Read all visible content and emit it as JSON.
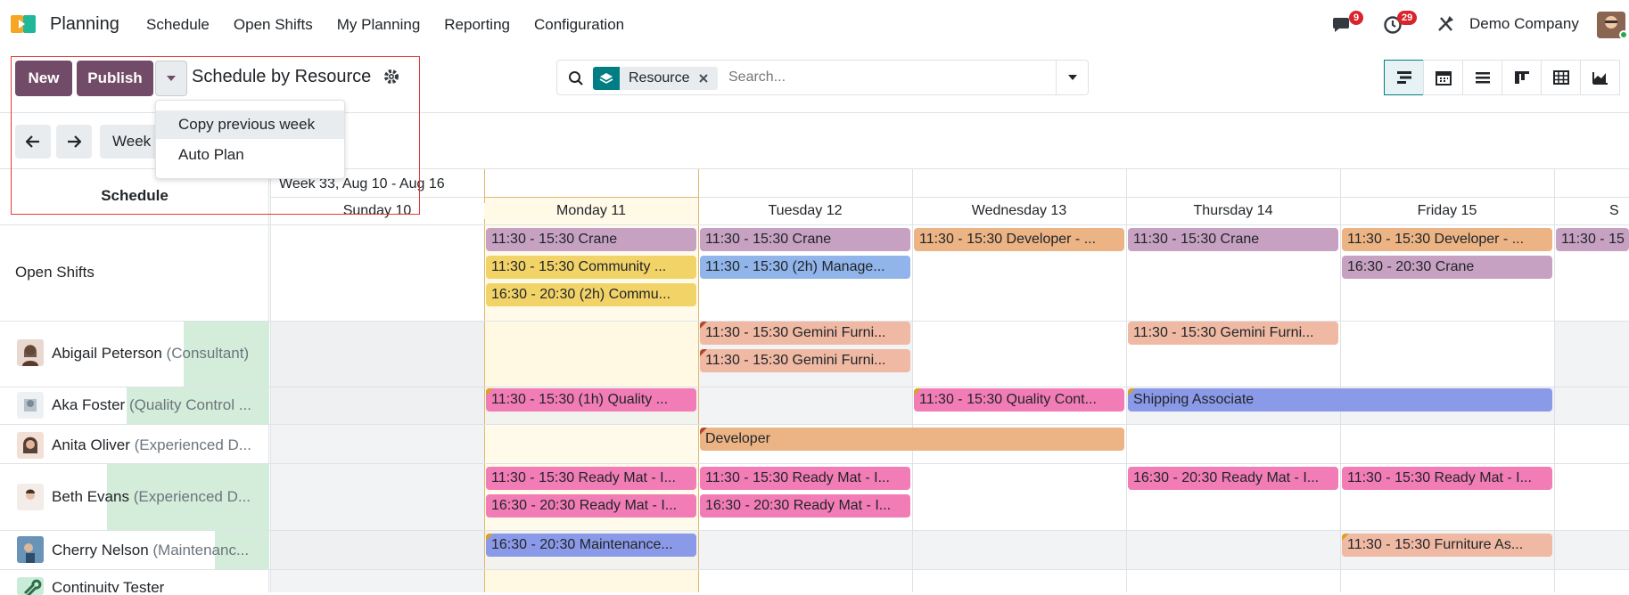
{
  "nav": {
    "app_name": "Planning",
    "menu": [
      "Schedule",
      "Open Shifts",
      "My Planning",
      "Reporting",
      "Configuration"
    ],
    "messages_count": "9",
    "activities_count": "29",
    "company": "Demo Company"
  },
  "control": {
    "new_label": "New",
    "publish_label": "Publish",
    "title": "Schedule by Resource",
    "facet": "Resource",
    "search_placeholder": "Search...",
    "dropdown": [
      "Copy previous week",
      "Auto Plan"
    ],
    "week_label": "Week"
  },
  "gantt": {
    "left_header": "Schedule",
    "range_label": "Week 33, Aug 10 - Aug 16",
    "days": [
      "Sunday 10",
      "Monday 11",
      "Tuesday 12",
      "Wednesday 13",
      "Thursday 14",
      "Friday 15",
      "S"
    ],
    "rows": [
      {
        "name": "Open Shifts",
        "role": ""
      },
      {
        "name": "Abigail Peterson",
        "role": "(Consultant)"
      },
      {
        "name": "Aka Foster",
        "role": "(Quality Control ..."
      },
      {
        "name": "Anita Oliver",
        "role": "(Experienced D..."
      },
      {
        "name": "Beth Evans",
        "role": "(Experienced D..."
      },
      {
        "name": "Cherry Nelson",
        "role": "(Maintenanc..."
      },
      {
        "name": "Continuity Tester",
        "role": ""
      }
    ],
    "shifts": {
      "os_mon_1": "11:30 - 15:30 Crane",
      "os_mon_2": "11:30 - 15:30 Community ...",
      "os_mon_3": "16:30 - 20:30 (2h) Commu...",
      "os_tue_1": "11:30 - 15:30 Crane",
      "os_tue_2": "11:30 - 15:30 (2h) Manage...",
      "os_wed_1": "11:30 - 15:30 Developer - ...",
      "os_thu_1": "11:30 - 15:30 Crane",
      "os_fri_1": "11:30 - 15:30 Developer - ...",
      "os_fri_2": "16:30 - 20:30 Crane",
      "os_sat_1": "11:30 - 15",
      "ab_tue_1": "11:30 - 15:30 Gemini Furni...",
      "ab_tue_2": "11:30 - 15:30 Gemini Furni...",
      "ab_thu_1": "11:30 - 15:30 Gemini Furni...",
      "ak_mon_1": "11:30 - 15:30 (1h) Quality ...",
      "ak_wed_1": "11:30 - 15:30 Quality Cont...",
      "ak_thu_1": "Shipping Associate",
      "an_tue_1": "Developer",
      "be_mon_1": "11:30 - 15:30 Ready Mat - I...",
      "be_mon_2": "16:30 - 20:30 Ready Mat - I...",
      "be_tue_1": "11:30 - 15:30 Ready Mat - I...",
      "be_tue_2": "16:30 - 20:30 Ready Mat - I...",
      "be_thu_1": "16:30 - 20:30 Ready Mat - I...",
      "be_fri_1": "11:30 - 15:30 Ready Mat - I...",
      "ch_mon_1": "16:30 - 20:30 Maintenance...",
      "ch_fri_1": "11:30 - 15:30 Furniture As..."
    }
  },
  "colors": {
    "brand": "#714b67",
    "teal": "#017e84",
    "crane": "#c6a1c2",
    "community": "#f2d368",
    "manager": "#91b5ea",
    "developer": "#ecb484",
    "gemini": "#f0b9a4",
    "quality": "#f27cb6",
    "shipping": "#8b9ae8",
    "today": "#fff9e6",
    "weekend": "#e9ecef"
  }
}
